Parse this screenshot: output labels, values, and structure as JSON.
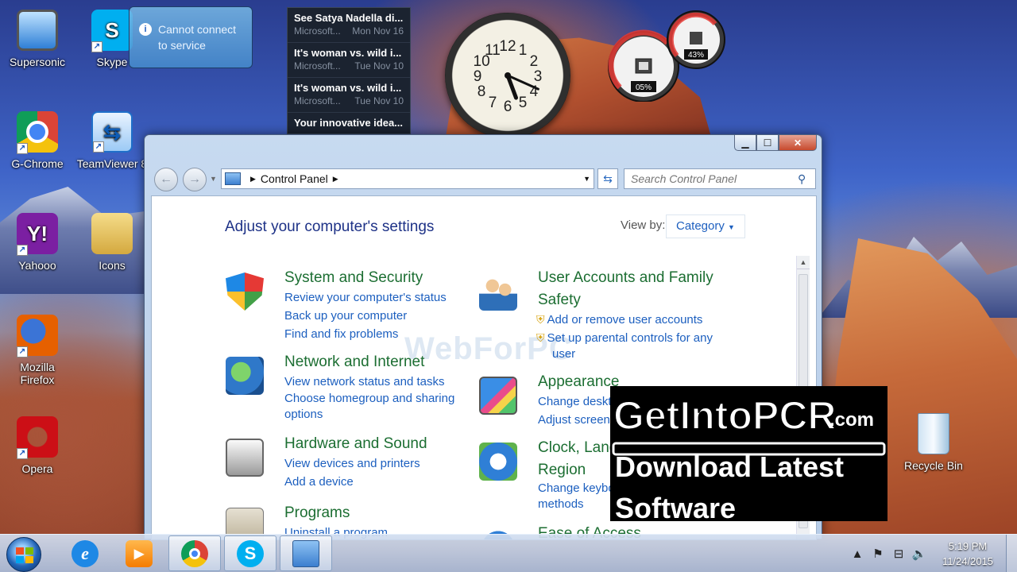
{
  "desktop": {
    "icons": [
      {
        "label": "Supersonic",
        "glyph": "monitor-icon"
      },
      {
        "label": "Skype",
        "glyph": "skype-icon"
      },
      {
        "label": "G-Chrome",
        "glyph": "chrome-icon"
      },
      {
        "label": "TeamViewer 8",
        "glyph": "teamviewer-icon"
      },
      {
        "label": "Yahooo",
        "glyph": "yahoo-icon"
      },
      {
        "label": "Icons",
        "glyph": "folder-icon"
      },
      {
        "label": "Mozilla Firefox",
        "glyph": "firefox-icon"
      },
      {
        "label": "Opera",
        "glyph": "opera-icon"
      },
      {
        "label": "Recycle Bin",
        "glyph": "recycle-bin-icon"
      }
    ]
  },
  "notification": {
    "text": "Cannot connect to service"
  },
  "news_gadget": {
    "items": [
      {
        "headline": "See Satya Nadella di...",
        "source": "Microsoft...",
        "date": "Mon Nov 16"
      },
      {
        "headline": "It's woman vs. wild i...",
        "source": "Microsoft...",
        "date": "Tue Nov 10"
      },
      {
        "headline": "It's woman vs. wild i...",
        "source": "Microsoft...",
        "date": "Tue Nov 10"
      },
      {
        "headline": "Your innovative idea...",
        "source": "",
        "date": ""
      }
    ]
  },
  "clock_gadget": {
    "numbers": [
      "12",
      "1",
      "2",
      "3",
      "4",
      "5",
      "6",
      "7",
      "8",
      "9",
      "10",
      "11"
    ],
    "hour": 5,
    "minute": 19
  },
  "meter_gadget": {
    "cpu": "05%",
    "memory": "43%"
  },
  "window": {
    "address": {
      "crumb": "Control Panel"
    },
    "search": {
      "placeholder": "Search Control Panel"
    },
    "heading": "Adjust your computer's settings",
    "view_by_label": "View by:",
    "view_by_value": "Category",
    "watermark": "WebForPC",
    "categories": [
      {
        "title": "System and Security",
        "links": [
          "Review your computer's status",
          "Back up your computer",
          "Find and fix problems"
        ]
      },
      {
        "title": "Network and Internet",
        "links": [
          "View network status and tasks",
          "Choose homegroup and sharing",
          "options"
        ]
      },
      {
        "title": "Hardware and Sound",
        "links": [
          "View devices and printers",
          "Add a device"
        ]
      },
      {
        "title": "Programs",
        "links": [
          "Uninstall a program"
        ]
      },
      {
        "title": "User Accounts and Family",
        "title2": "Safety",
        "links": [
          "Add or remove user accounts",
          "Set up parental controls for any",
          "user"
        ]
      },
      {
        "title": "Appearance",
        "links": [
          "Change desktop background",
          "Adjust screen resolution"
        ]
      },
      {
        "title": "Clock, Language, and",
        "title2": "Region",
        "links": [
          "Change keyboards or other input",
          "methods"
        ]
      },
      {
        "title": "Ease of Access",
        "links": []
      }
    ]
  },
  "banner": {
    "brand": "GetIntoPCR",
    "domain": ".com",
    "line1": "Download Latest",
    "line2": "Software"
  },
  "taskbar": {
    "apps": [
      "internet-explorer-icon",
      "media-player-icon",
      "chrome-icon",
      "skype-icon",
      "control-panel-icon"
    ],
    "time": "5:19 PM",
    "date": "11/24/2015"
  }
}
